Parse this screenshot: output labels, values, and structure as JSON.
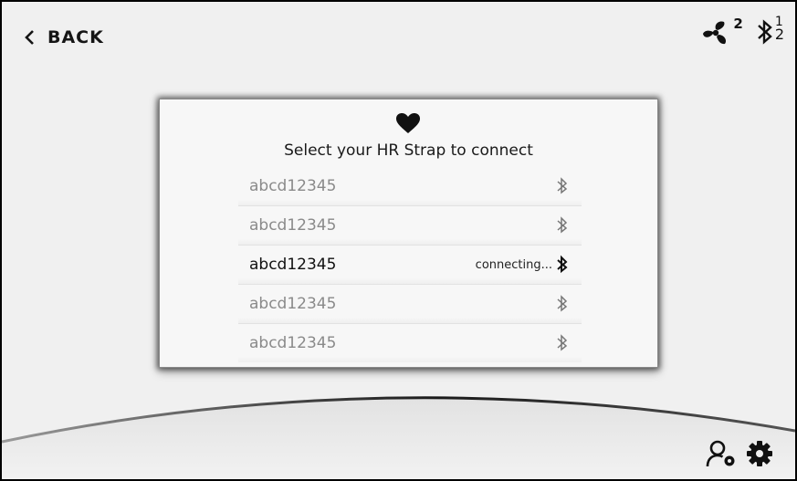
{
  "header": {
    "back_label": "BACK",
    "fan_level": "2",
    "bt_connection_top": "1",
    "bt_connection_bottom": "2"
  },
  "dialog": {
    "icon": "heart-icon",
    "title": "Select your HR Strap to connect",
    "devices": [
      {
        "name": "abcd12345",
        "status": "",
        "state": "available"
      },
      {
        "name": "abcd12345",
        "status": "",
        "state": "available"
      },
      {
        "name": "abcd12345",
        "status": "connecting...",
        "state": "connecting"
      },
      {
        "name": "abcd12345",
        "status": "",
        "state": "available"
      },
      {
        "name": "abcd12345",
        "status": "",
        "state": "available"
      }
    ]
  },
  "footer": {
    "profile_settings_icon": "user-settings-icon",
    "settings_icon": "gear-icon"
  },
  "colors": {
    "background": "#f0f0f0",
    "panel": "#f7f7f7",
    "text_dark": "#111111",
    "text_muted": "#8a8a8a"
  }
}
